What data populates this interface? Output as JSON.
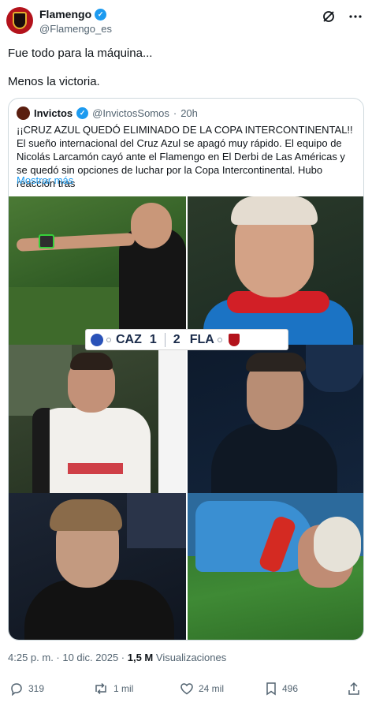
{
  "author": {
    "display_name": "Flamengo",
    "handle": "@Flamengo_es"
  },
  "tweet": {
    "line1": "Fue todo para la máquina...",
    "line2": "Menos la victoria."
  },
  "quote": {
    "display_name": "Invictos",
    "handle": "@InvictosSomos",
    "separator": "·",
    "age": "20h",
    "text": "¡¡CRUZ AZUL QUEDÓ ELIMINADO DE LA COPA INTERCONTINENTAL!! El sueño internacional del Cruz Azul se apagó muy rápido. El equipo de Nicolás Larcamón cayó ante el Flamengo en El Derbi de Las Américas y se quedó sin opciones de luchar por la Copa Intercontinental. Hubo reacción tras",
    "show_more": "Mostrar más"
  },
  "scoreboard": {
    "home": "CAZ",
    "home_score": "1",
    "away_score": "2",
    "away": "FLA"
  },
  "meta": {
    "time_date": "4:25 p. m. · 10 dic. 2025 · ",
    "views_count": "1,5 M",
    "views_label": " Visualizaciones"
  },
  "actions": {
    "replies": "319",
    "reposts": "1 mil",
    "likes": "24 mil",
    "bookmarks": "496"
  },
  "icons": {
    "verified": "verified-badge-icon",
    "grok": "grok-icon",
    "more": "more-options-icon"
  },
  "colors": {
    "accent": "#1d9bf0",
    "text": "#0f1419",
    "muted": "#536471",
    "border": "#cfd9de"
  }
}
